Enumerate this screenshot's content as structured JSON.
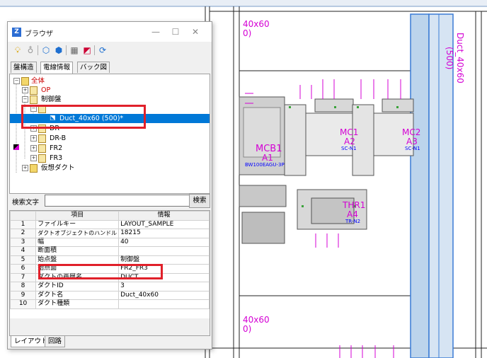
{
  "canvas": {
    "duct_top_label_1": "40x60",
    "duct_top_label_2": "0)",
    "duct_bottom_label_1": "40x60",
    "duct_bottom_label_2": "0)",
    "duct_vertical_label_1": "Duct_40x60",
    "duct_vertical_label_2": "(500)",
    "mcb_label": "MCB1",
    "mcb_ref": "A1",
    "mcb_model": "BW100EAGU-3P",
    "mc1_label": "MC1",
    "mc1_ref": "A2",
    "mc1_model": "SC-N1",
    "mc2_label": "MC2",
    "mc2_ref": "A3",
    "mc2_model": "SC-N1",
    "thr_label": "THR1",
    "thr_ref": "A4",
    "thr_model": "TR-N2",
    "colors": {
      "magenta": "#d400d4",
      "blue": "#0000ff",
      "duct_fill": "#bcd4ec"
    }
  },
  "window": {
    "title": "ブラウザ",
    "minimize": "—",
    "maximize": "☐",
    "close": "✕"
  },
  "toolbar": {
    "icons": [
      "bulb-on-icon",
      "bulb-off-icon",
      "cube-icon",
      "cube-alt-icon",
      "grid-icon",
      "window-icon",
      "refresh-icon"
    ]
  },
  "tabs": [
    {
      "label": "盤構造",
      "active": false
    },
    {
      "label": "電線情報",
      "active": true
    },
    {
      "label": "バック図",
      "active": false
    }
  ],
  "tree": {
    "root": "全体",
    "op": "OP",
    "control_panel": "制御盤",
    "duct_item": "Duct_40x60 (500)*",
    "dr": "DR",
    "dr_b": "DR-B",
    "fr2": "FR2",
    "fr3": "FR3",
    "virtual_duct": "仮想ダクト"
  },
  "search": {
    "label": "検索文字",
    "value": "",
    "button": "検索"
  },
  "grid": {
    "headers": [
      "",
      "項目",
      "情報"
    ],
    "rows": [
      {
        "num": "1",
        "item": "ファイルキー",
        "info": "LAYOUT_SAMPLE"
      },
      {
        "num": "2",
        "item": "ダクトオブジェクトのハンドル",
        "info": "18215"
      },
      {
        "num": "3",
        "item": "幅",
        "info": "40"
      },
      {
        "num": "4",
        "item": "断面積",
        "info": ""
      },
      {
        "num": "5",
        "item": "始点盤",
        "info": "制御盤"
      },
      {
        "num": "6",
        "item": "始点面",
        "info": "FR2_FR3"
      },
      {
        "num": "7",
        "item": "ダクトの画層名",
        "info": "DUCT"
      },
      {
        "num": "8",
        "item": "ダクトID",
        "info": "3"
      },
      {
        "num": "9",
        "item": "ダクト名",
        "info": "Duct_40x60"
      },
      {
        "num": "10",
        "item": "ダクト種類",
        "info": ""
      }
    ]
  },
  "bottom_tabs": [
    {
      "label": "レイアウト",
      "active": true
    },
    {
      "label": "回路",
      "active": false
    }
  ]
}
